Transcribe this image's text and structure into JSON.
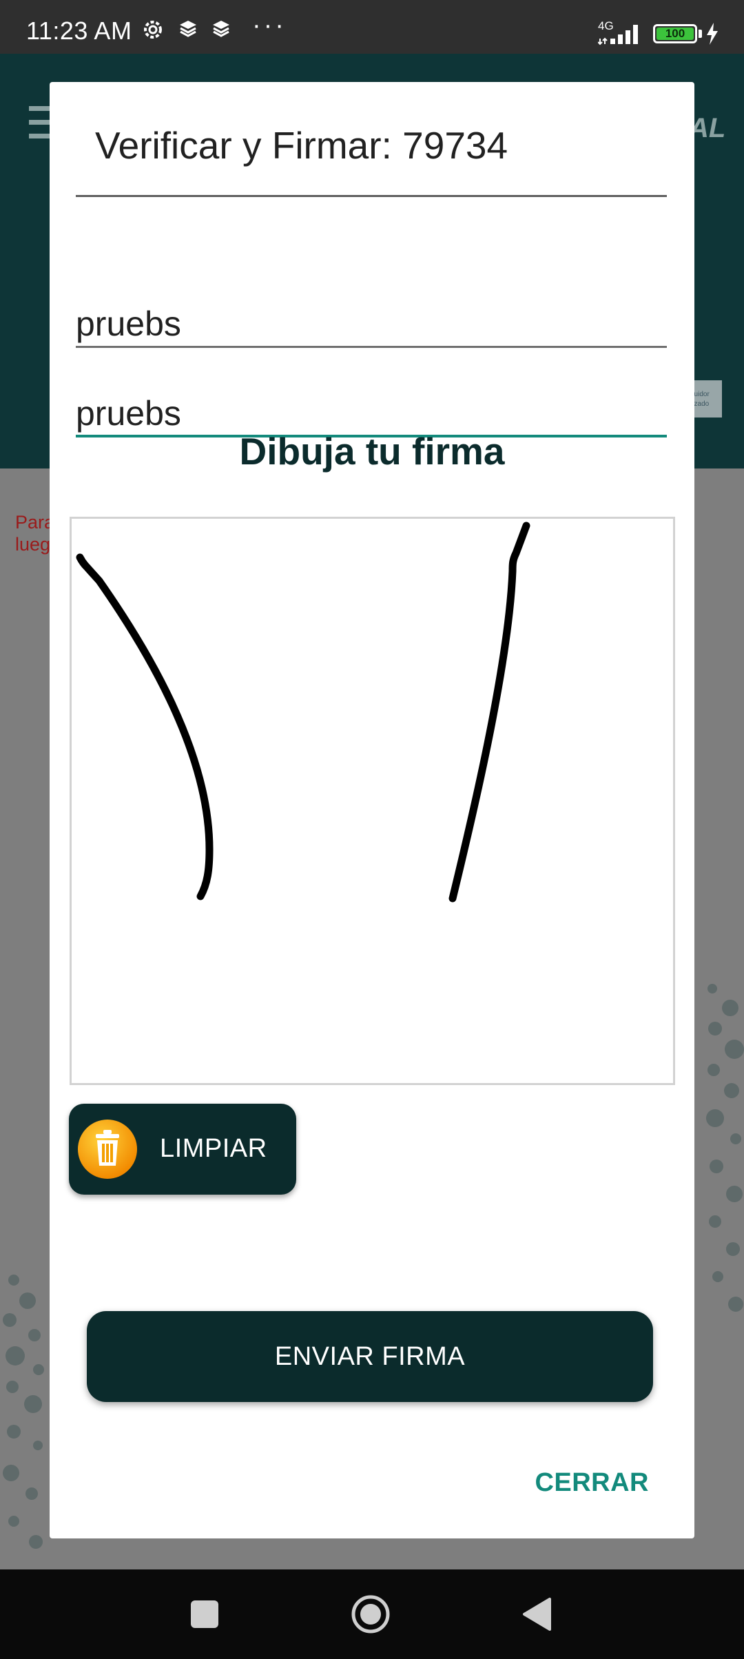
{
  "status_bar": {
    "time": "11:23 AM",
    "overflow": "···",
    "network": "4G",
    "battery": "100",
    "icons": [
      "settings-gear-icon",
      "layers-icon",
      "layers-icon",
      "signal-icon",
      "battery-icon",
      "charging-bolt-icon"
    ]
  },
  "background_app": {
    "logo_text": "AL",
    "badge_text": "buidor rizado",
    "message_line1": "Para",
    "message_line2": "lueg"
  },
  "dialog": {
    "title": "Verificar y Firmar: 79734",
    "field1_value": "pruebs",
    "field2_value": "pruebs",
    "draw_heading": "Dibuja tu firma",
    "clear_label": "LIMPIAR",
    "send_label": "ENVIAR FIRMA",
    "close_label": "CERRAR"
  },
  "nav_bar": {
    "buttons": [
      "recent-apps",
      "home",
      "back"
    ]
  },
  "colors": {
    "primary_dark": "#0b2b2c",
    "accent_teal": "#138a7c",
    "battery_green": "#3cc33c",
    "clear_icon_orange": "#f7a800"
  }
}
